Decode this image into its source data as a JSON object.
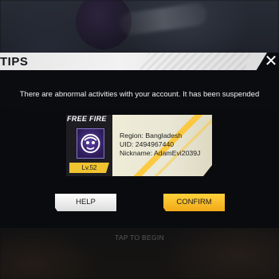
{
  "dialog": {
    "title": "TIPS",
    "close_glyph": "✕",
    "message": "There are abnormal activities with your account. It has been suspended"
  },
  "account": {
    "brand": "FREE FIRE",
    "avatar_icon": "purple-emblem-avatar",
    "level": "Lv.52",
    "region": "Region: Bangladesh",
    "uid": "UID: 2494967440",
    "nickname": "Nickname: AdamEvi2039J"
  },
  "buttons": {
    "help": "HELP",
    "confirm": "CONFIRM"
  },
  "background": {
    "tap_hint": "TAP TO BEGIN"
  },
  "colors": {
    "accent_yellow": "#f2b51f",
    "header_bg": "#ececec",
    "panel_bg": "#0a0b0e",
    "avatar_purple": "#4b2f8a"
  }
}
